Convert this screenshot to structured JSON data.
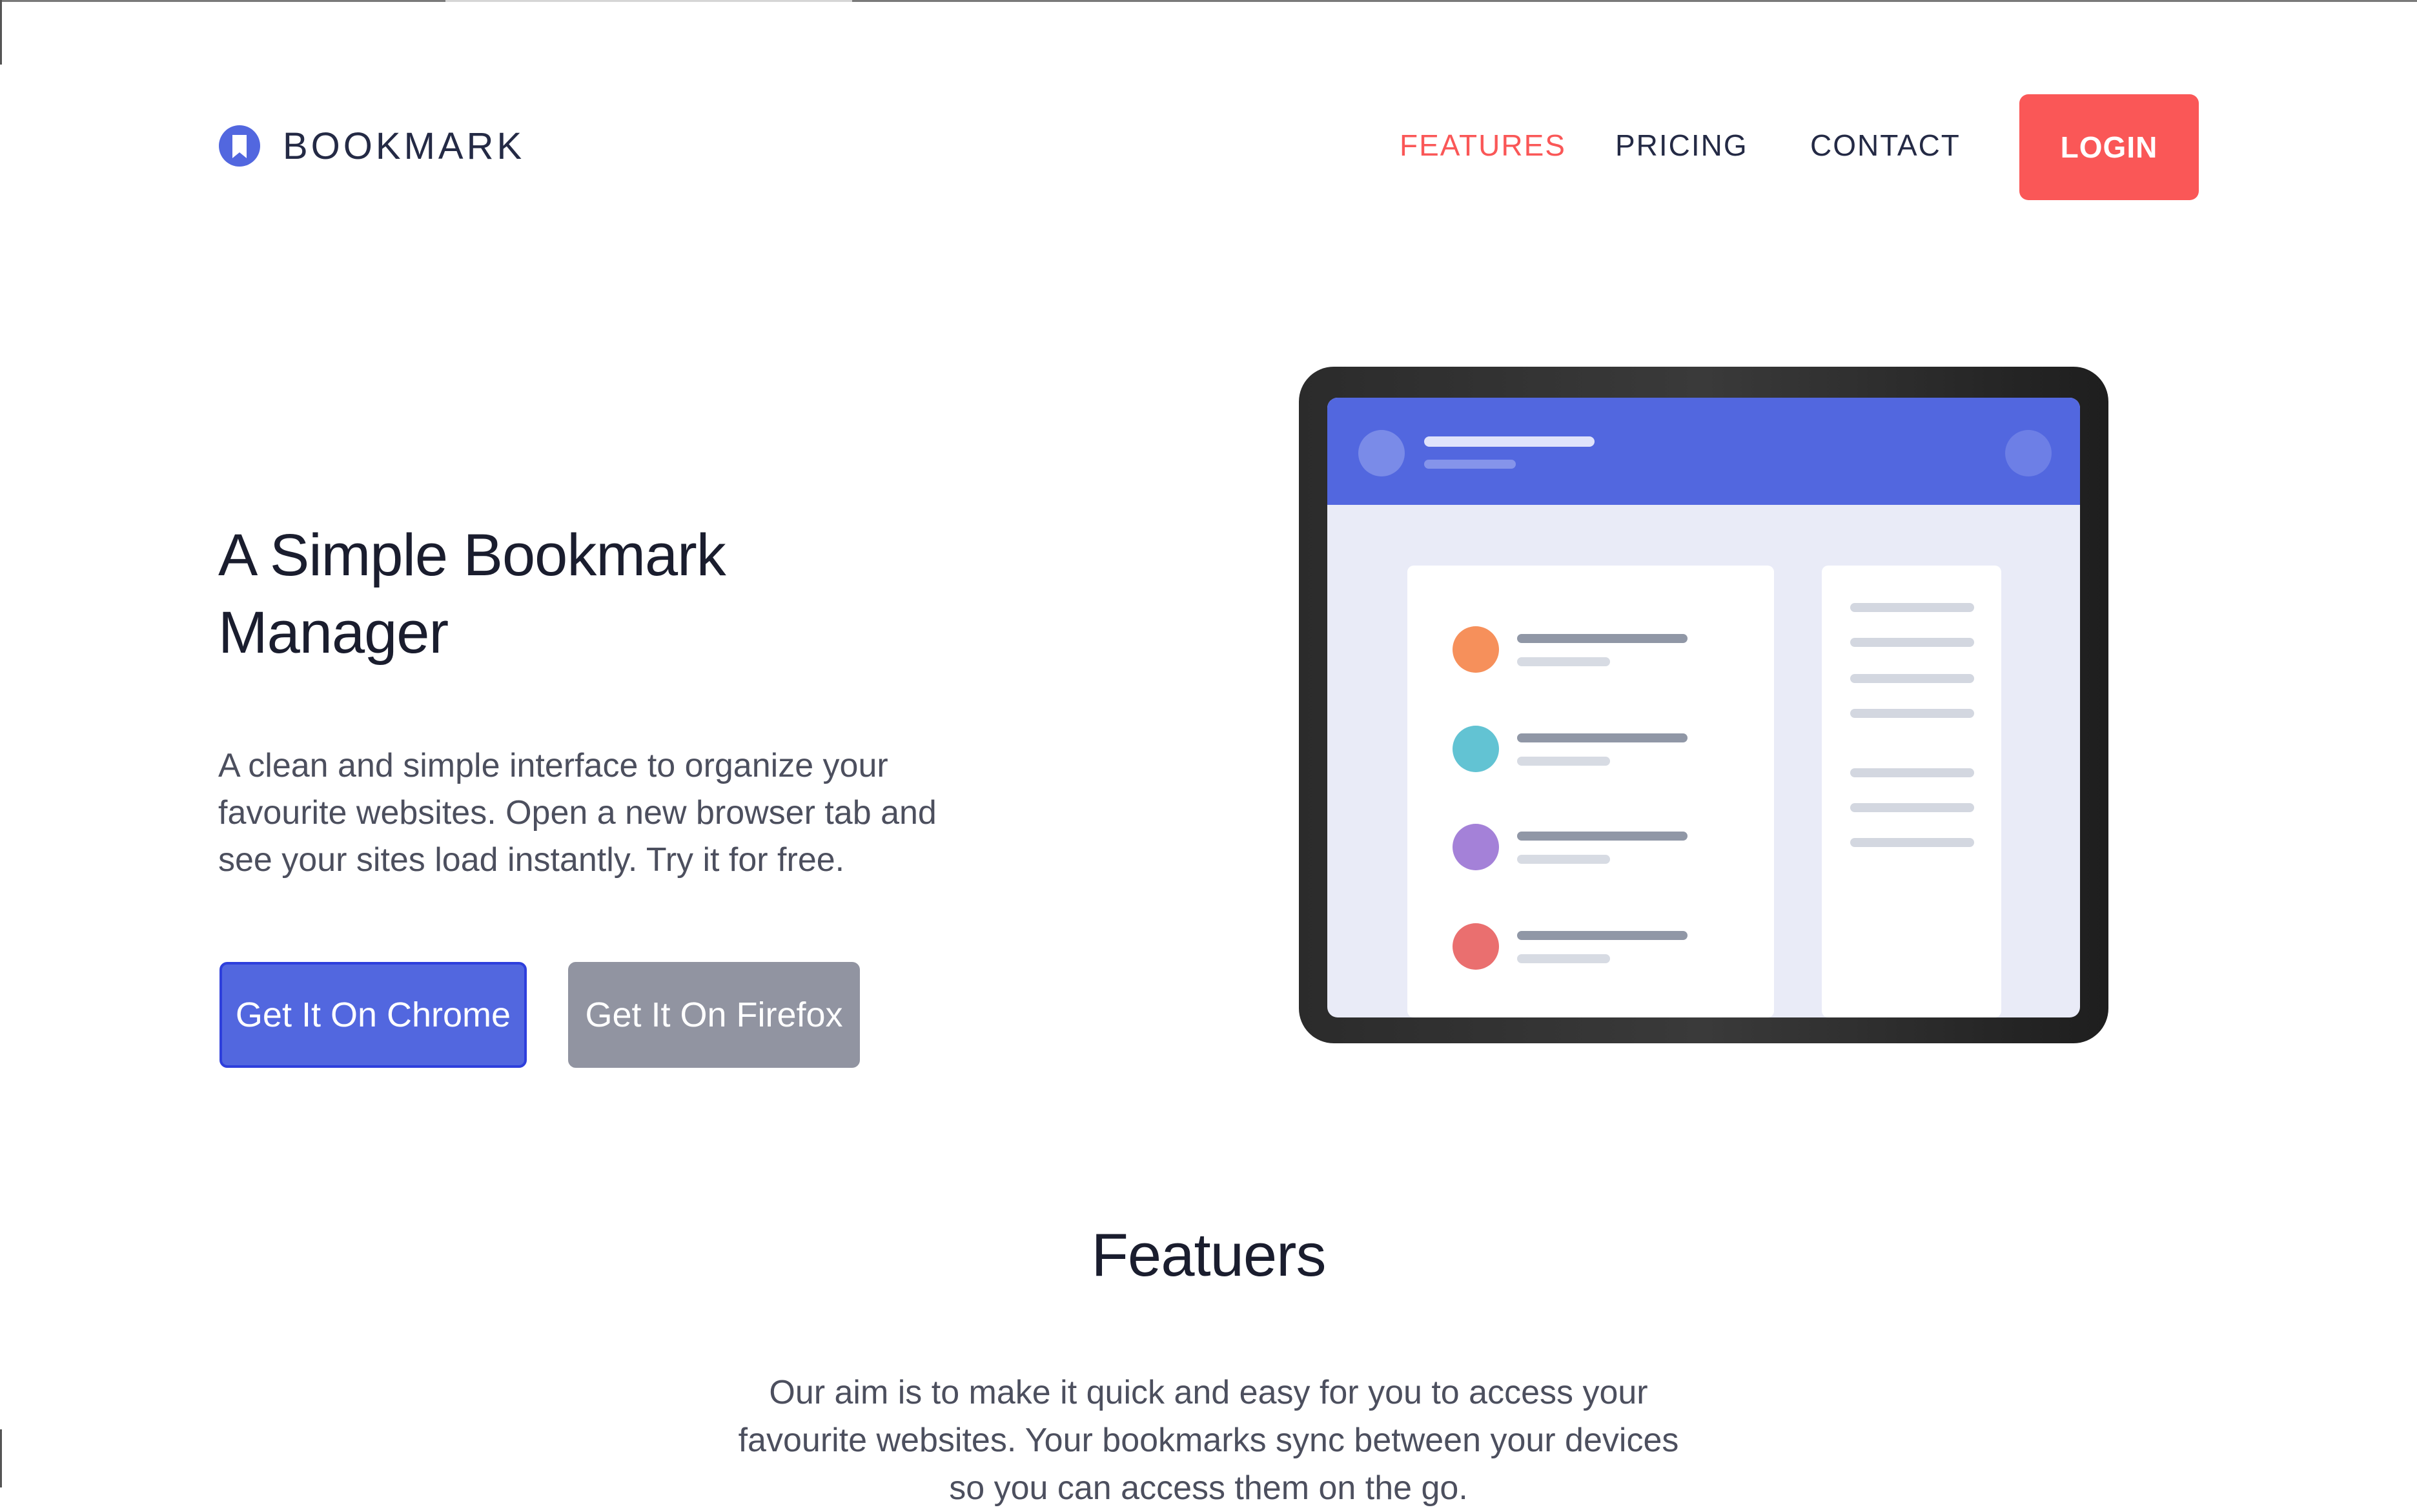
{
  "brand": {
    "name": "BOOKMARK",
    "icon": "bookmark-icon",
    "color": "#5267df"
  },
  "nav": {
    "items": [
      {
        "label": "FEATURES",
        "active": true
      },
      {
        "label": "PRICING",
        "active": false
      },
      {
        "label": "CONTACT",
        "active": false
      }
    ],
    "login_label": "LOGIN"
  },
  "hero": {
    "title": "A Simple Bookmark Manager",
    "description": "A clean and simple interface to organize your favourite websites. Open a new browser tab and see your sites load instantly. Try it for free.",
    "chrome_button": "Get It On Chrome",
    "firefox_button": "Get It On Firefox"
  },
  "illustration": {
    "icon": "tablet-illustration",
    "list_dot_colors": [
      "#f6905b",
      "#62c3d3",
      "#a481d8",
      "#ea6f6f"
    ]
  },
  "features": {
    "title": "Featuers",
    "description": "Our aim is to make it quick and easy for you to access your favourite websites. Your bookmarks sync between your devices so you can access them on the go."
  },
  "colors": {
    "accent_red": "#fa5757",
    "primary_blue": "#5267df",
    "gray_button": "#9194a1",
    "text_dark": "#242a45"
  }
}
